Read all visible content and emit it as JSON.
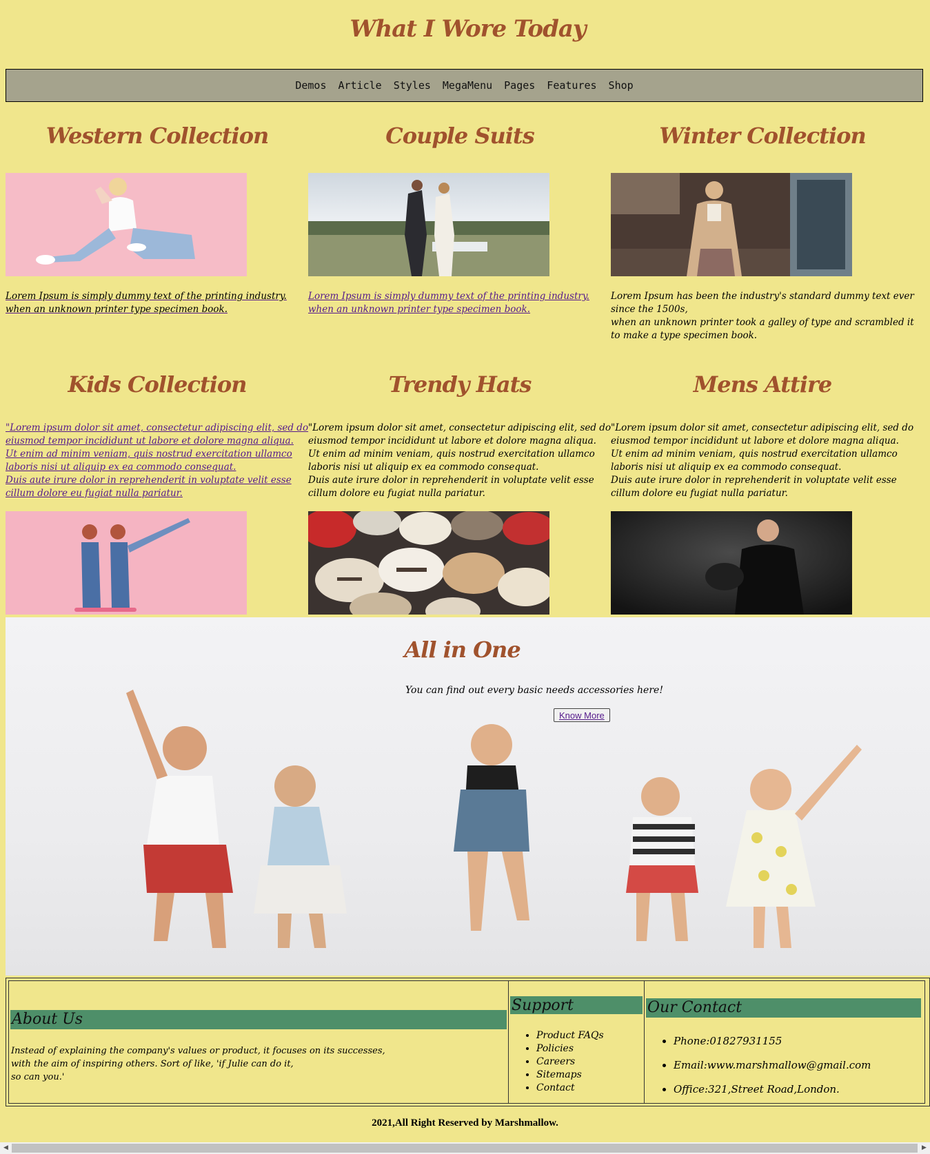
{
  "site": {
    "title": "What I Wore Today"
  },
  "nav": [
    "Demos",
    "Article",
    "Styles",
    "MegaMenu",
    "Pages",
    "Features",
    "Shop"
  ],
  "row1": [
    {
      "title": "Western Collection",
      "lines": [
        "Lorem Ipsum is simply dummy text of the printing industry.",
        "when an unknown printer type specimen book."
      ]
    },
    {
      "title": "Couple Suits",
      "lines": [
        "Lorem Ipsum is simply dummy text of the printing industry.",
        "when an unknown printer type specimen book."
      ]
    },
    {
      "title": "Winter Collection",
      "lines": [
        "Lorem Ipsum has been the industry's standard dummy text ever since the 1500s,",
        "when an unknown printer took a galley of type and scrambled it to make a type specimen book."
      ]
    }
  ],
  "row2": [
    {
      "title": "Kids Collection",
      "lines": [
        "\"Lorem ipsum dolor sit amet, consectetur adipiscing elit, sed do eiusmod tempor incididunt ut labore et dolore magna aliqua.",
        "Ut enim ad minim veniam, quis nostrud exercitation ullamco laboris nisi ut aliquip ex ea commodo consequat.",
        "Duis aute irure dolor in reprehenderit in voluptate velit esse cillum dolore eu fugiat nulla pariatur."
      ]
    },
    {
      "title": "Trendy Hats",
      "lines": [
        "\"Lorem ipsum dolor sit amet, consectetur adipiscing elit, sed do eiusmod tempor incididunt ut labore et dolore magna aliqua.",
        "Ut enim ad minim veniam, quis nostrud exercitation ullamco laboris nisi ut aliquip ex ea commodo consequat.",
        "Duis aute irure dolor in reprehenderit in voluptate velit esse cillum dolore eu fugiat nulla pariatur."
      ]
    },
    {
      "title": "Mens Attire",
      "lines": [
        "\"Lorem ipsum dolor sit amet, consectetur adipiscing elit, sed do eiusmod tempor incididunt ut labore et dolore magna aliqua.",
        "Ut enim ad minim veniam, quis nostrud exercitation ullamco laboris nisi ut aliquip ex ea commodo consequat.",
        "Duis aute irure dolor in reprehenderit in voluptate velit esse cillum dolore eu fugiat nulla pariatur."
      ]
    }
  ],
  "hero": {
    "title": "All in One",
    "text": "You can find out every basic needs accessories here!",
    "button": "Know More"
  },
  "footer": {
    "about": {
      "heading": "About Us",
      "lines": [
        "Instead of explaining the company's values or product, it focuses on its successes,",
        "with the aim of inspiring others. Sort of like, 'if Julie can do it,",
        "so can you.'"
      ]
    },
    "support": {
      "heading": "Support",
      "items": [
        "Product FAQs",
        "Policies",
        "Careers",
        "Sitemaps",
        "Contact"
      ]
    },
    "contact": {
      "heading": "Our Contact",
      "items": [
        "Phone:01827931155",
        "Email:www.marshmallow@gmail.com",
        "Office:321,Street Road,London."
      ]
    }
  },
  "copyright": "2021,All Right Reserved by Marshmallow.",
  "scroll_icons": [
    "scroll-left-icon",
    "scroll-right-icon"
  ]
}
